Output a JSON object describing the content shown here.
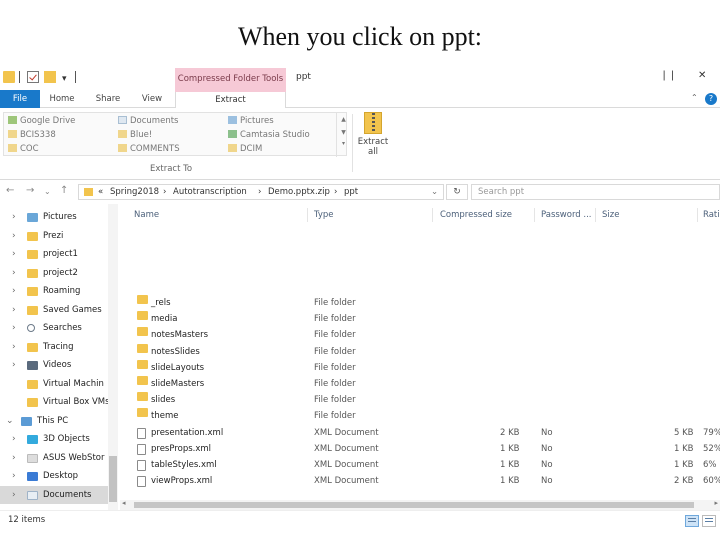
{
  "slide_title": "When you click on ppt:",
  "window": {
    "title": "ppt",
    "contextual_tab": "Compressed Folder Tools",
    "controls": [
      "❘❘",
      "✕"
    ]
  },
  "ribbon": {
    "tabs": [
      "File",
      "Home",
      "Share",
      "View",
      "Extract"
    ],
    "destinations": [
      [
        "Google Drive",
        "Documents",
        "Pictures"
      ],
      [
        "BCIS338",
        "Blue!",
        "Camtasia Studio"
      ],
      [
        "COC",
        "COMMENTS",
        "DCIM"
      ]
    ],
    "group_label": "Extract To",
    "extract_all": "Extract all"
  },
  "address": {
    "crumbs": [
      "«",
      "Spring2018",
      "›",
      "Autotranscription",
      "›",
      "Demo.pptx.zip",
      "›",
      "ppt"
    ],
    "search_placeholder": "Search ppt"
  },
  "nav": [
    {
      "label": "Pictures",
      "icon": "pictures-icon",
      "chev": "›"
    },
    {
      "label": "Prezi",
      "icon": "folder-icon",
      "chev": "›"
    },
    {
      "label": "project1",
      "icon": "folder-icon",
      "chev": "›"
    },
    {
      "label": "project2",
      "icon": "folder-icon",
      "chev": "›"
    },
    {
      "label": "Roaming",
      "icon": "folder-icon",
      "chev": "›"
    },
    {
      "label": "Saved Games",
      "icon": "folder-icon",
      "chev": "›"
    },
    {
      "label": "Searches",
      "icon": "search-icon",
      "chev": "›"
    },
    {
      "label": "Tracing",
      "icon": "folder-icon",
      "chev": "›"
    },
    {
      "label": "Videos",
      "icon": "videos-icon",
      "chev": "›"
    },
    {
      "label": "Virtual Machin",
      "icon": "folder-icon",
      "chev": ""
    },
    {
      "label": "Virtual Box VMs",
      "icon": "folder-icon",
      "chev": ""
    },
    {
      "label": "This PC",
      "icon": "this-pc-icon",
      "chev": "⌄"
    },
    {
      "label": "3D Objects",
      "icon": "3d-objects-icon",
      "chev": "›"
    },
    {
      "label": "ASUS WebStor",
      "icon": "asus-icon",
      "chev": "›"
    },
    {
      "label": "Desktop",
      "icon": "desktop-icon",
      "chev": "›"
    },
    {
      "label": "Documents",
      "icon": "documents-icon",
      "chev": "›"
    }
  ],
  "columns": [
    "Name",
    "Type",
    "Compressed size",
    "Password ...",
    "Size",
    "Ratio"
  ],
  "files": [
    {
      "name": "_rels",
      "type": "File folder",
      "comp": "",
      "pw": "",
      "size": "",
      "ratio": "",
      "kind": "folder"
    },
    {
      "name": "media",
      "type": "File folder",
      "comp": "",
      "pw": "",
      "size": "",
      "ratio": "",
      "kind": "folder"
    },
    {
      "name": "notesMasters",
      "type": "File folder",
      "comp": "",
      "pw": "",
      "size": "",
      "ratio": "",
      "kind": "folder"
    },
    {
      "name": "notesSlides",
      "type": "File folder",
      "comp": "",
      "pw": "",
      "size": "",
      "ratio": "",
      "kind": "folder"
    },
    {
      "name": "slideLayouts",
      "type": "File folder",
      "comp": "",
      "pw": "",
      "size": "",
      "ratio": "",
      "kind": "folder"
    },
    {
      "name": "slideMasters",
      "type": "File folder",
      "comp": "",
      "pw": "",
      "size": "",
      "ratio": "",
      "kind": "folder"
    },
    {
      "name": "slides",
      "type": "File folder",
      "comp": "",
      "pw": "",
      "size": "",
      "ratio": "",
      "kind": "folder"
    },
    {
      "name": "theme",
      "type": "File folder",
      "comp": "",
      "pw": "",
      "size": "",
      "ratio": "",
      "kind": "folder"
    },
    {
      "name": "presentation.xml",
      "type": "XML Document",
      "comp": "2 KB",
      "pw": "No",
      "size": "5 KB",
      "ratio": "79%",
      "kind": "xml"
    },
    {
      "name": "presProps.xml",
      "type": "XML Document",
      "comp": "1 KB",
      "pw": "No",
      "size": "1 KB",
      "ratio": "52%",
      "kind": "xml"
    },
    {
      "name": "tableStyles.xml",
      "type": "XML Document",
      "comp": "1 KB",
      "pw": "No",
      "size": "1 KB",
      "ratio": "6%",
      "kind": "xml"
    },
    {
      "name": "viewProps.xml",
      "type": "XML Document",
      "comp": "1 KB",
      "pw": "No",
      "size": "2 KB",
      "ratio": "60%",
      "kind": "xml"
    }
  ],
  "status": "12 items"
}
